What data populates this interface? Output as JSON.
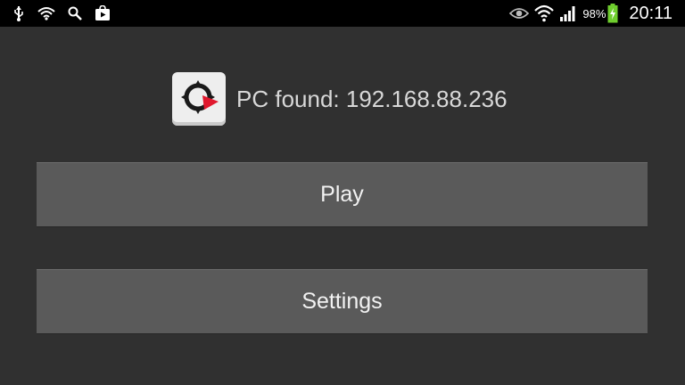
{
  "status_bar": {
    "left_icons": [
      "usb-icon",
      "wifi-signal-icon",
      "search-icon",
      "play-store-icon"
    ],
    "right_icons": [
      "eye-icon",
      "wifi-icon",
      "cell-signal-icon",
      "battery-icon"
    ],
    "battery_percent": "98%",
    "time": "20:11"
  },
  "header": {
    "app_icon": "compass-app-icon",
    "status_text": "PC found: 192.168.88.236"
  },
  "buttons": {
    "play_label": "Play",
    "settings_label": "Settings"
  },
  "colors": {
    "background": "#303030",
    "button": "#5a5a5a",
    "status_bar": "#000000",
    "accent_red": "#e0182d",
    "battery_green": "#6fce2e"
  }
}
